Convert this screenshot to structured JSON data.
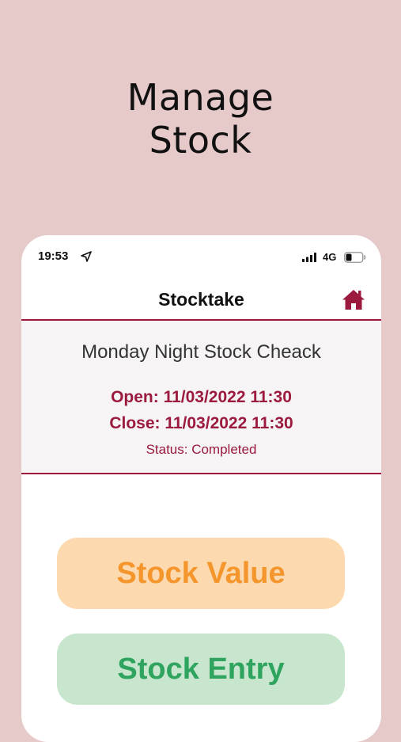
{
  "promo": {
    "line1": "Manage",
    "line2": "Stock"
  },
  "status_bar": {
    "time": "19:53",
    "network": "4G",
    "location_icon": "location-arrow-icon",
    "signal_icon": "signal-bars-icon",
    "battery_icon": "battery-icon"
  },
  "nav": {
    "title": "Stocktake",
    "home_icon": "home-icon"
  },
  "stocktake": {
    "name": "Monday Night Stock Cheack",
    "open": "Open: 11/03/2022 11:30",
    "close": "Close: 11/03/2022 11:30",
    "status": "Status: Completed"
  },
  "actions": {
    "stock_value_label": "Stock Value",
    "stock_entry_label": "Stock Entry"
  },
  "colors": {
    "background": "#e6caca",
    "accent": "#9b1a3e",
    "stock_value_bg": "#fdd9b0",
    "stock_value_text": "#f4962c",
    "stock_entry_bg": "#c7e6cd",
    "stock_entry_text": "#2ea45e"
  }
}
